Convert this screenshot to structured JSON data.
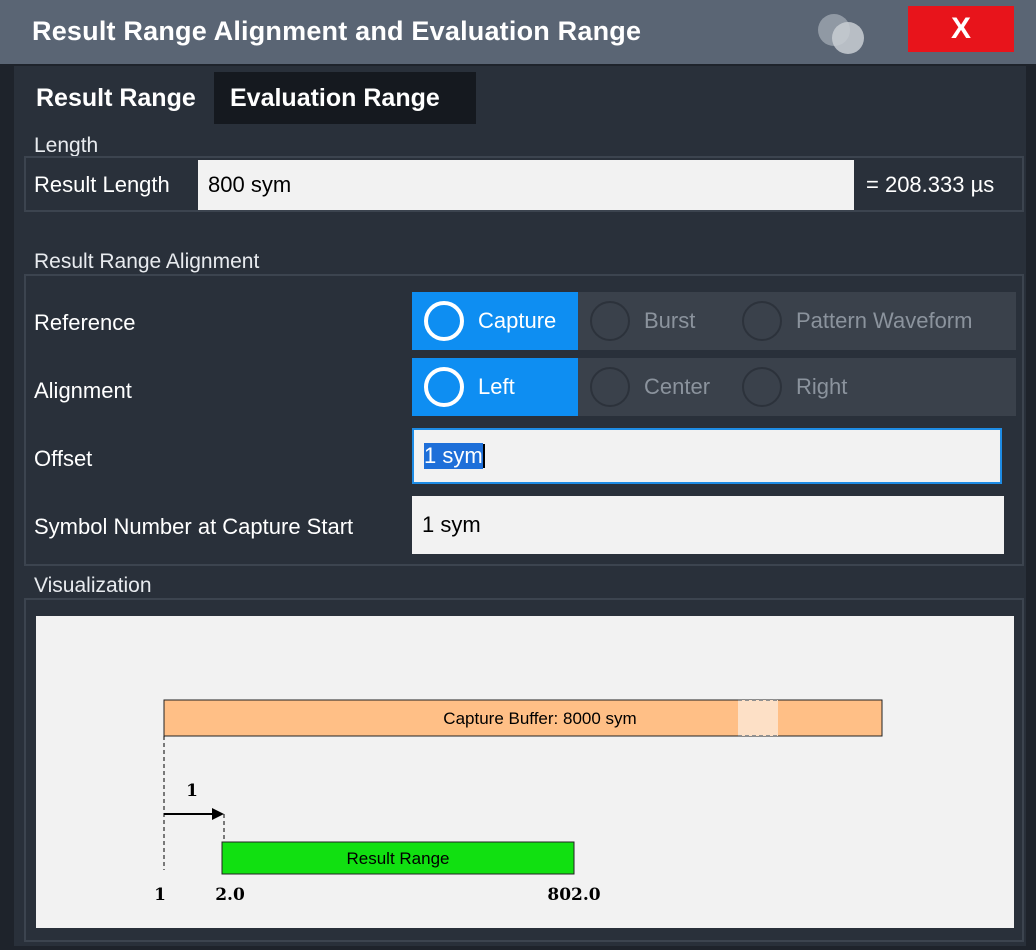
{
  "window": {
    "title": "Result Range Alignment and Evaluation Range",
    "close_label": "X"
  },
  "tabs": [
    {
      "label": "Result Range",
      "active": true
    },
    {
      "label": "Evaluation Range",
      "active": false
    }
  ],
  "length": {
    "section_label": "Length",
    "result_length_label": "Result Length",
    "result_length_value": "800 sym",
    "result_length_time": "= 208.333 µs"
  },
  "alignment": {
    "section_label": "Result Range Alignment",
    "reference": {
      "label": "Reference",
      "options": [
        "Capture",
        "Burst",
        "Pattern Waveform"
      ],
      "selected": "Capture"
    },
    "alignment": {
      "label": "Alignment",
      "options": [
        "Left",
        "Center",
        "Right"
      ],
      "selected": "Left"
    },
    "offset": {
      "label": "Offset",
      "value": "1 sym"
    },
    "symbol_number": {
      "label": "Symbol Number at Capture Start",
      "value": "1 sym"
    }
  },
  "visualization": {
    "section_label": "Visualization",
    "capture_buffer_label": "Capture Buffer: 8000 sym",
    "result_range_label": "Result Range",
    "offset_label": "1",
    "start_label": "1",
    "range_start_label": "2.0",
    "range_end_label": "802.0"
  },
  "colors": {
    "capture_buffer": "#ffbf86",
    "result_range": "#11e011",
    "accent": "#0e8ef2",
    "close": "#e8141b"
  }
}
